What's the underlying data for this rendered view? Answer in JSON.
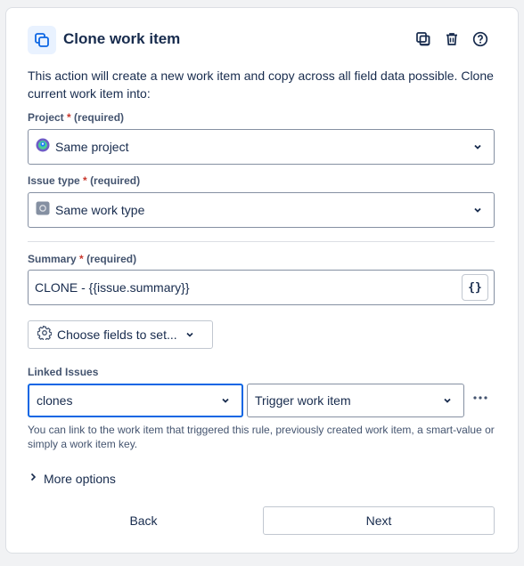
{
  "header": {
    "title": "Clone work item",
    "icons": [
      "clone-icon",
      "copy-icon",
      "trash-icon",
      "help-icon"
    ]
  },
  "description": "This action will create a new work item and copy across all field data possible. Clone current work item into:",
  "project": {
    "label": "Project",
    "required_marker": "*",
    "required_text": "(required)",
    "value": "Same project",
    "icon": "project-avatar-icon"
  },
  "issue_type": {
    "label": "Issue type",
    "required_marker": "*",
    "required_text": "(required)",
    "value": "Same work type",
    "icon": "work-type-icon"
  },
  "summary": {
    "label": "Summary",
    "required_marker": "*",
    "required_text": "(required)",
    "value": "CLONE - {{issue.summary}}",
    "smart_value_button": "{}"
  },
  "choose_fields": {
    "label": "Choose fields to set...",
    "icon": "gear-icon"
  },
  "linked_issues": {
    "label": "Linked Issues",
    "link_type": "clones",
    "target": "Trigger work item",
    "hint": "You can link to the work item that triggered this rule, previously created work item, a smart-value or simply a work item key.",
    "more_icon": "more-horizontal-icon"
  },
  "more_options": {
    "label": "More options"
  },
  "footer": {
    "back_label": "Back",
    "next_label": "Next"
  },
  "colors": {
    "accent": "#0c66e4",
    "required": "#c9372c",
    "border": "#8590a2",
    "text": "#172b4d",
    "subtle_text": "#44546f"
  }
}
